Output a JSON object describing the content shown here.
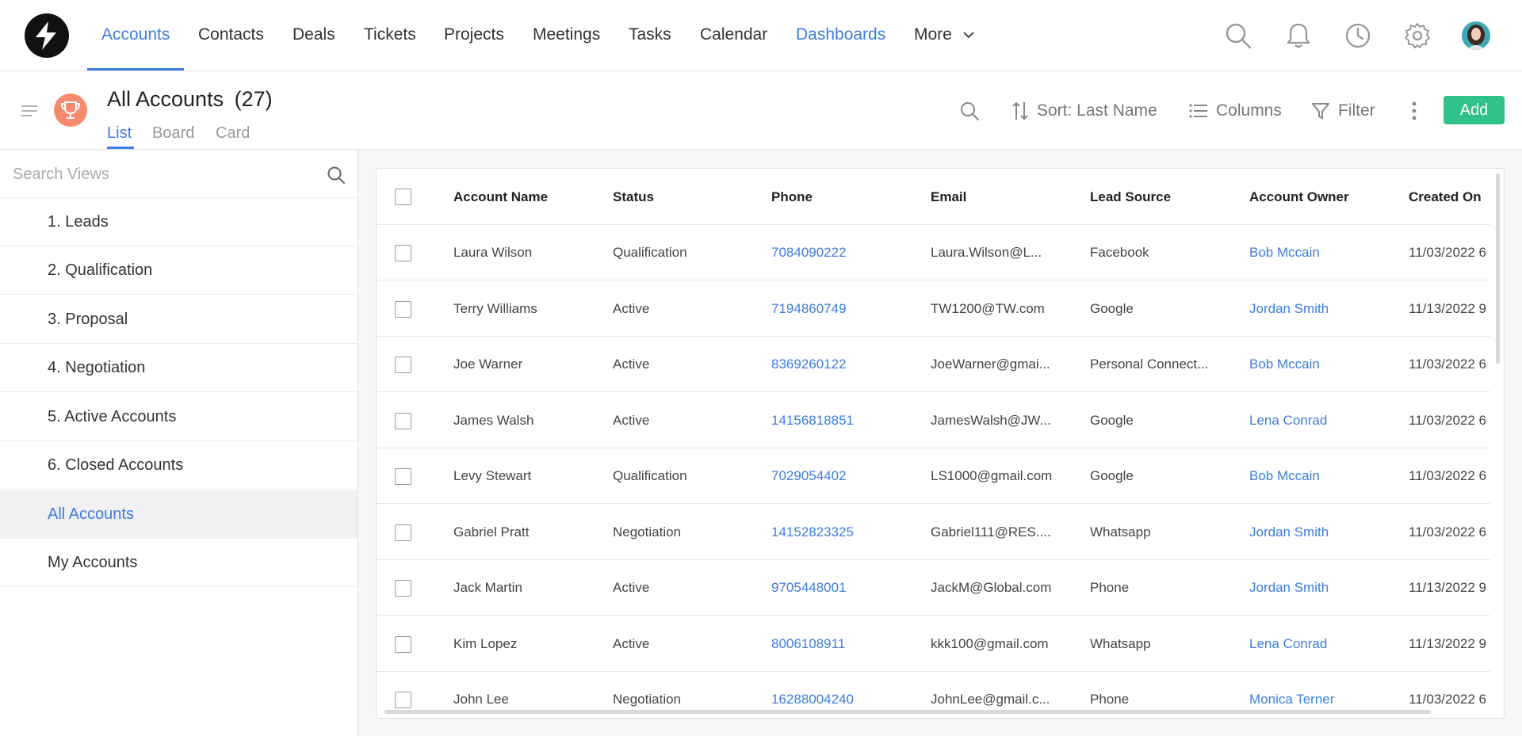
{
  "nav": {
    "items": [
      {
        "label": "Accounts",
        "active": true
      },
      {
        "label": "Contacts",
        "active": false
      },
      {
        "label": "Deals",
        "active": false
      },
      {
        "label": "Tickets",
        "active": false
      },
      {
        "label": "Projects",
        "active": false
      },
      {
        "label": "Meetings",
        "active": false
      },
      {
        "label": "Tasks",
        "active": false
      },
      {
        "label": "Calendar",
        "active": false
      },
      {
        "label": "Dashboards",
        "active": false
      }
    ],
    "more_label": "More",
    "icons": [
      "search-icon",
      "bell-icon",
      "clock-icon",
      "gear-icon"
    ]
  },
  "header": {
    "title": "All Accounts",
    "count": "(27)",
    "view_tabs": [
      "List",
      "Board",
      "Card"
    ],
    "active_tab": "List",
    "sort_label": "Sort: Last Name",
    "columns_label": "Columns",
    "filter_label": "Filter",
    "add_label": "Add"
  },
  "sidebar": {
    "search_placeholder": "Search Views",
    "views": [
      "1. Leads",
      "2. Qualification",
      "3. Proposal",
      "4. Negotiation",
      "5. Active Accounts",
      "6. Closed Accounts",
      "All Accounts",
      "My Accounts"
    ],
    "selected": "All Accounts"
  },
  "table": {
    "columns": [
      "Account Name",
      "Status",
      "Phone",
      "Email",
      "Lead Source",
      "Account Owner",
      "Created On"
    ],
    "rows": [
      [
        "Laura Wilson",
        "Qualification",
        "7084090222",
        "Laura.Wilson@L...",
        "Facebook",
        "Bob Mccain",
        "11/03/2022 6"
      ],
      [
        "Terry Williams",
        "Active",
        "7194860749",
        "TW1200@TW.com",
        "Google",
        "Jordan Smith",
        "11/13/2022 9"
      ],
      [
        "Joe Warner",
        "Active",
        "8369260122",
        "JoeWarner@gmai...",
        "Personal Connect...",
        "Bob Mccain",
        "11/03/2022 6"
      ],
      [
        "James Walsh",
        "Active",
        "14156818851",
        "JamesWalsh@JW...",
        "Google",
        "Lena Conrad",
        "11/03/2022 6"
      ],
      [
        "Levy Stewart",
        "Qualification",
        "7029054402",
        "LS1000@gmail.com",
        "Google",
        "Bob Mccain",
        "11/03/2022 6"
      ],
      [
        "Gabriel Pratt",
        "Negotiation",
        "14152823325",
        "Gabriel111@RES....",
        "Whatsapp",
        "Jordan Smith",
        "11/03/2022 6"
      ],
      [
        "Jack Martin",
        "Active",
        "9705448001",
        "JackM@Global.com",
        "Phone",
        "Jordan Smith",
        "11/13/2022 9"
      ],
      [
        "Kim Lopez",
        "Active",
        "8006108911",
        "kkk100@gmail.com",
        "Whatsapp",
        "Lena Conrad",
        "11/13/2022 9"
      ],
      [
        "John Lee",
        "Negotiation",
        "16288004240",
        "JohnLee@gmail.c...",
        "Phone",
        "Monica Terner",
        "11/03/2022 6"
      ]
    ]
  },
  "colors": {
    "accent": "#3d7de0",
    "add_button": "#2fc38a",
    "trophy_badge": "#f58b6e"
  }
}
